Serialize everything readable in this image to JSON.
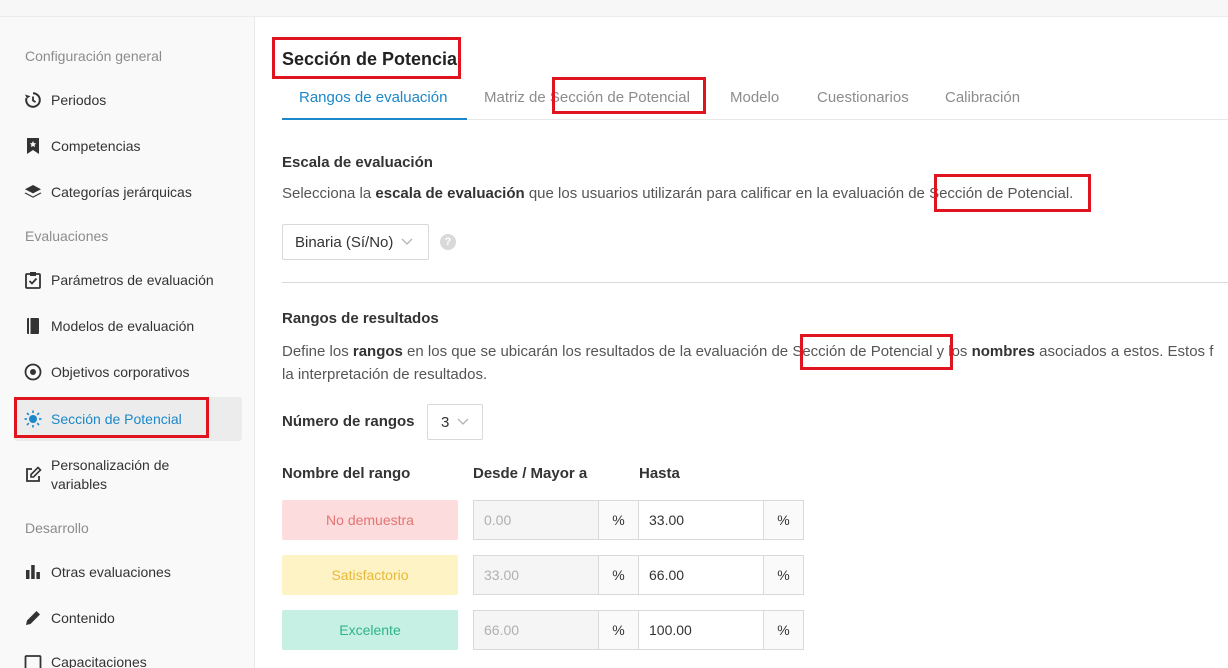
{
  "sidebar": {
    "sections": [
      {
        "label": "Configuración general"
      },
      {
        "label": "Evaluaciones"
      },
      {
        "label": "Desarrollo"
      }
    ],
    "items": [
      {
        "label": "Periodos",
        "icon": "history-icon"
      },
      {
        "label": "Competencias",
        "icon": "bookmark-star-icon"
      },
      {
        "label": "Categorías jerárquicas",
        "icon": "layers-icon"
      },
      {
        "label": "Parámetros de evaluación",
        "icon": "clipboard-check-icon"
      },
      {
        "label": "Modelos de evaluación",
        "icon": "book-icon"
      },
      {
        "label": "Objetivos corporativos",
        "icon": "target-icon"
      },
      {
        "label": "Sección de Potencial",
        "icon": "sun-icon",
        "active": true
      },
      {
        "label": "Personalización de variables",
        "icon": "edit-square-icon"
      },
      {
        "label": "Otras evaluaciones",
        "icon": "bar-chart-icon"
      },
      {
        "label": "Contenido",
        "icon": "pencil-icon"
      },
      {
        "label": "Capacitaciones",
        "icon": "square-icon"
      }
    ]
  },
  "page": {
    "title": "Sección de Potencial",
    "tabs": [
      {
        "label": "Rangos de evaluación",
        "active": true
      },
      {
        "label": "Matriz de Sección de Potencial"
      },
      {
        "label": "Modelo"
      },
      {
        "label": "Cuestionarios"
      },
      {
        "label": "Calibración"
      }
    ]
  },
  "scale": {
    "title": "Escala de evaluación",
    "desc_prefix": "Selecciona la ",
    "desc_bold": "escala de evaluación",
    "desc_middle": " que los usuarios utilizarán para calificar en la evaluación de ",
    "desc_highlight": "Sección de Potencial.",
    "selected": "Binaria (Sí/No)",
    "help": "?"
  },
  "ranges": {
    "title": "Rangos de resultados",
    "line1_prefix": "Define los ",
    "line1_bold1": "rangos",
    "line1_middle": " en los que se ubicarán los resultados de la evaluación de ",
    "line1_highlight": "Sección de Potencial",
    "line1_and": " y los ",
    "line1_bold2": "nombres",
    "line1_suffix": " asociados a estos. Estos f",
    "line2": "la interpretación de resultados.",
    "count_label": "Número de rangos",
    "count_value": "3",
    "headers": {
      "name": "Nombre del rango",
      "from": "Desde / Mayor a",
      "to": "Hasta"
    },
    "rows": [
      {
        "name": "No demuestra",
        "from": "0.00",
        "to": "33.00",
        "unit": "%",
        "bg": "#fcdcdc",
        "fg": "#e57373"
      },
      {
        "name": "Satisfactorio",
        "from": "33.00",
        "to": "66.00",
        "unit": "%",
        "bg": "#fdf3c4",
        "fg": "#e8b93a"
      },
      {
        "name": "Excelente",
        "from": "66.00",
        "to": "100.00",
        "unit": "%",
        "bg": "#c6f0e3",
        "fg": "#2fb38b"
      }
    ]
  },
  "colors": {
    "accent": "#1c87c9",
    "highlight_box": "#e0141e"
  }
}
